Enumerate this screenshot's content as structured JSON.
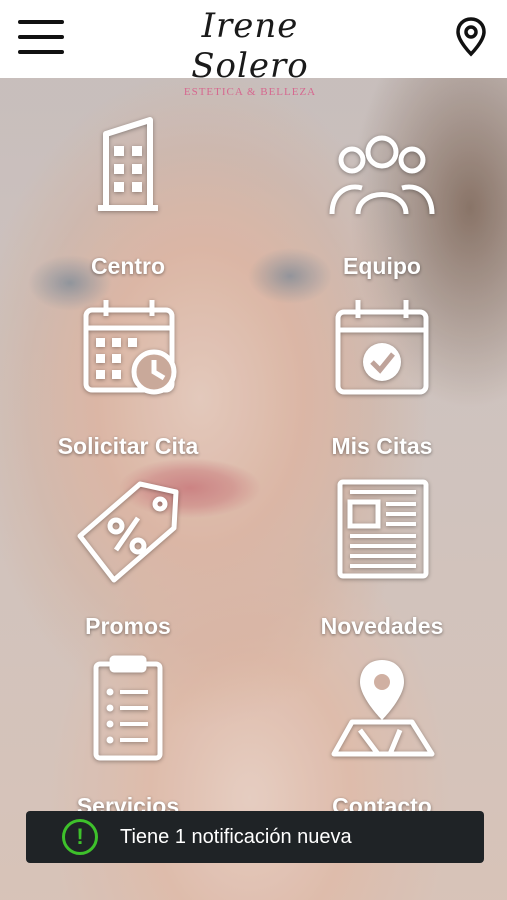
{
  "header": {
    "logo_name": "Irene Solero",
    "logo_sub": "ESTETICA & BELLEZA",
    "menu_icon": "hamburger-menu-icon",
    "location_icon": "map-pin-icon"
  },
  "grid": {
    "items": [
      {
        "label": "Centro",
        "icon": "building-icon"
      },
      {
        "label": "Equipo",
        "icon": "team-icon"
      },
      {
        "label": "Solicitar Cita",
        "icon": "calendar-clock-icon"
      },
      {
        "label": "Mis Citas",
        "icon": "calendar-check-icon"
      },
      {
        "label": "Promos",
        "icon": "percent-tag-icon"
      },
      {
        "label": "Novedades",
        "icon": "newspaper-icon"
      },
      {
        "label": "Servicios",
        "icon": "clipboard-list-icon"
      },
      {
        "label": "Contacto",
        "icon": "map-location-icon"
      }
    ]
  },
  "notification": {
    "text": "Tiene 1 notificación nueva",
    "icon": "exclamation-circle-icon",
    "icon_glyph": "!",
    "accent": "#3ec12b"
  },
  "colors": {
    "brand_pink": "#d6688f",
    "toast_bg": "#1f2326",
    "icon_color": "#ffffff"
  }
}
